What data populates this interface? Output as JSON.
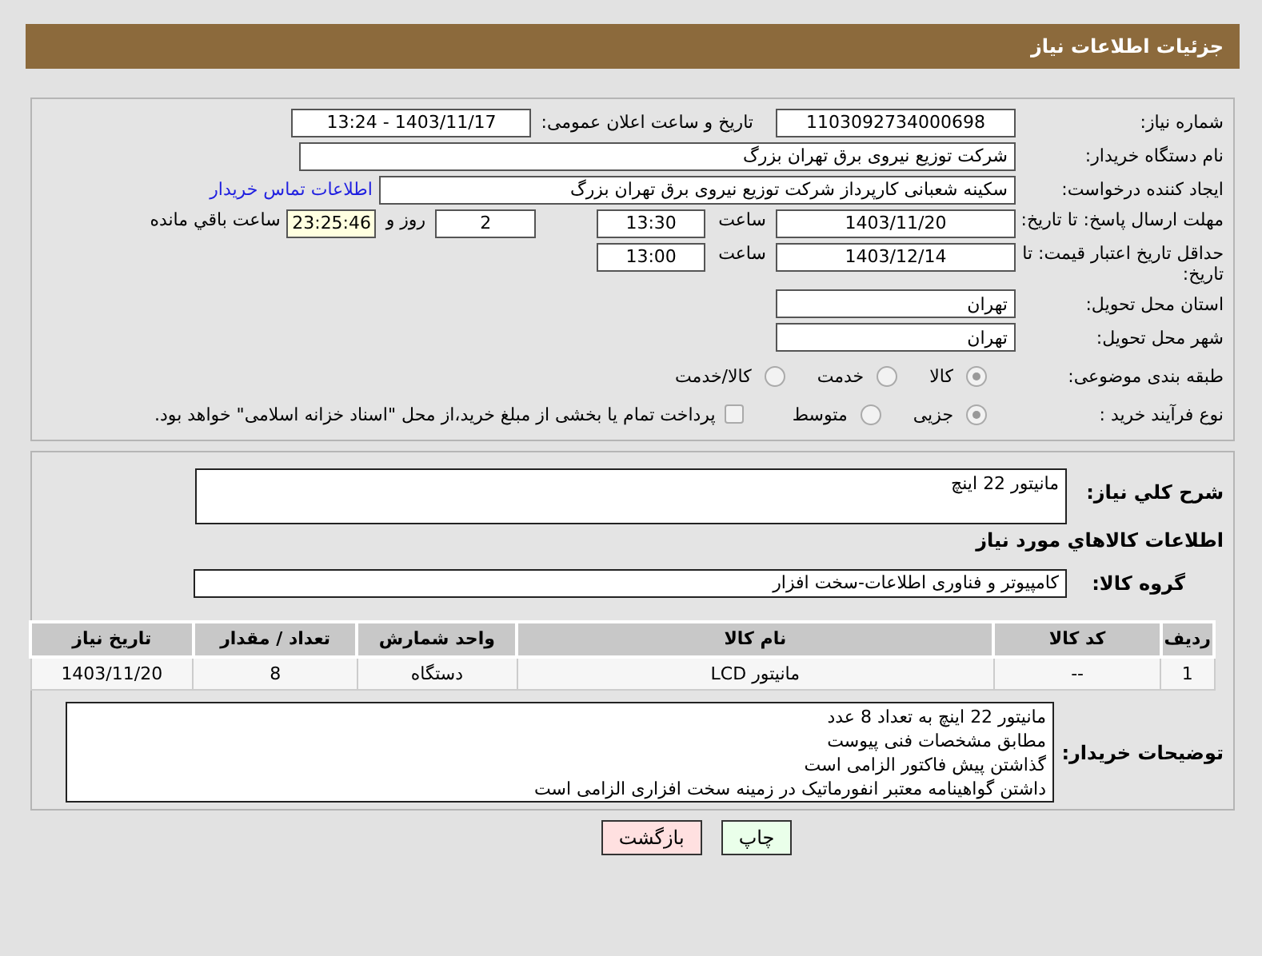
{
  "header": {
    "title": "جزئیات اطلاعات نیاز"
  },
  "need_number": {
    "label": "شماره نیاز:",
    "value": "1103092734000698"
  },
  "announce": {
    "label": "تاریخ و ساعت اعلان عمومی:",
    "value": "1403/11/17 - 13:24"
  },
  "buyer": {
    "label": "نام دستگاه خریدار:",
    "value": "شرکت توزیع نیروی برق تهران بزرگ"
  },
  "creator": {
    "label": "ایجاد کننده درخواست:",
    "value": "سکینه شعبانی کارپرداز شرکت توزیع نیروی برق تهران بزرگ",
    "link": "اطلاعات تماس خریدار"
  },
  "reply_deadline": {
    "label": "مهلت ارسال پاسخ: تا تاریخ:",
    "date": "1403/11/20",
    "time_label": "ساعت",
    "time": "13:30",
    "days": "2",
    "days_label": "روز و",
    "remaining": "23:25:46",
    "remaining_label": "ساعت باقي مانده"
  },
  "price_validity": {
    "label": "حداقل تاریخ اعتبار قیمت: تا تاریخ:",
    "date": "1403/12/14",
    "time_label": "ساعت",
    "time": "13:00"
  },
  "province": {
    "label": "استان محل تحویل:",
    "value": "تهران"
  },
  "city": {
    "label": "شهر محل تحویل:",
    "value": "تهران"
  },
  "category": {
    "label": "طبقه بندی موضوعی:",
    "options": [
      {
        "label": "کالا",
        "selected": true
      },
      {
        "label": "خدمت",
        "selected": false
      },
      {
        "label": "کالا/خدمت",
        "selected": false
      }
    ]
  },
  "process": {
    "label": "نوع فرآیند خرید :",
    "options": [
      {
        "label": "جزیی",
        "selected": true
      },
      {
        "label": "متوسط",
        "selected": false
      }
    ],
    "treasury": {
      "label": "پرداخت تمام یا بخشی از مبلغ خرید،از محل \"اسناد خزانه اسلامی\" خواهد بود.",
      "checked": false
    }
  },
  "summary": {
    "label": "شرح كلي نياز:",
    "value": "مانیتور 22 اینچ"
  },
  "goods_heading": "اطلاعات كالاهاي مورد نياز",
  "goods_group": {
    "label": "گروه کالا:",
    "value": "کامپیوتر و فناوری اطلاعات-سخت افزار"
  },
  "items_table": {
    "columns": [
      "ردیف",
      "کد کالا",
      "نام کالا",
      "واحد شمارش",
      "تعداد / مقدار",
      "تاریخ نیاز"
    ],
    "rows": [
      [
        "1",
        "--",
        "مانیتور LCD",
        "دستگاه",
        "8",
        "1403/11/20"
      ]
    ]
  },
  "buyer_notes": {
    "label": "توضیحات خریدار:",
    "lines": [
      "مانیتور 22 اینچ به تعداد 8 عدد",
      "مطابق مشخصات فنی پیوست",
      "گذاشتن پیش فاکتور الزامی است",
      "داشتن گواهینامه معتبر انفورماتیک در زمینه سخت افزاری الزامی است"
    ]
  },
  "buttons": [
    {
      "label": "چاپ",
      "kind": "print"
    },
    {
      "label": "بازگشت",
      "kind": "back"
    }
  ]
}
